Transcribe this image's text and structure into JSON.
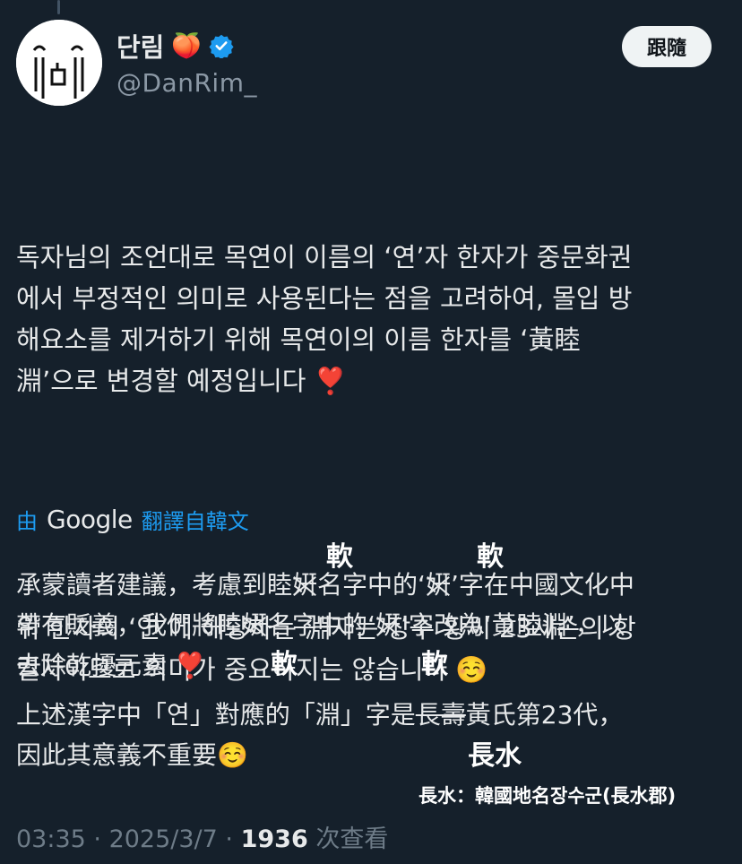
{
  "author": {
    "name": "단림",
    "name_emoji": "🍑",
    "handle": "@DanRim_",
    "verified": true
  },
  "follow_label": "跟隨",
  "original": {
    "p1": "독자님의 조언대로 목연이 이름의 ‘연’자 한자가 중문화권\n에서 부정적인 의미로 사용된다는 점을 고려하여, 몰입 방\n해요소를 제거하기 위해 목연이의 이름 한자를 ‘黃睦\n淵’으로 변경할 예정입니다 ❣️",
    "p2": "위 한자의 ‘연’에 해당하는 淵자는 장수 황씨 23세손의 항\n렬자이므로 의미가 중요하지는 않습니다 ☺️"
  },
  "translation_bar": {
    "prefix": "由",
    "brand": "Google",
    "label": "翻譯自韓文"
  },
  "translation": {
    "line1_a": "承蒙讀者建議，考慮到睦",
    "line1_x1": "姸",
    "line1_b": "名字中的‘",
    "line1_x2": "姸",
    "line1_c": "’字在中國文化中",
    "line2_a": "帶有貶義，我們將睦",
    "line2_x1": "姸",
    "line2_b": "名字中的‘",
    "line2_x2": "姸",
    "line2_c": "’字改為‘黃睦淵’，以",
    "line3": "去除乾擾元素 ❣️",
    "line4_a": "上述漢字中「연」對應的「淵」字是",
    "line4_strike": "長壽",
    "line4_b": "黃氏第23代，",
    "line5": "因此其意義不重要☺️"
  },
  "annotations": {
    "corr_top_1": "軟",
    "corr_top_2": "軟",
    "corr_bottom_1": "軟",
    "corr_bottom_2": "軟",
    "changshui": "長水",
    "footnote": "長水：韓國地名장수군(長水郡)"
  },
  "meta": {
    "time": "03:35",
    "sep1": " · ",
    "date": "2025/3/7",
    "sep2": " · ",
    "views": "1936",
    "views_label": " 次查看"
  },
  "colors": {
    "background": "#15202b",
    "text": "#e7e9ea",
    "muted": "#8b98a5",
    "link": "#1d9bf0",
    "verified": "#1d9bf0"
  }
}
